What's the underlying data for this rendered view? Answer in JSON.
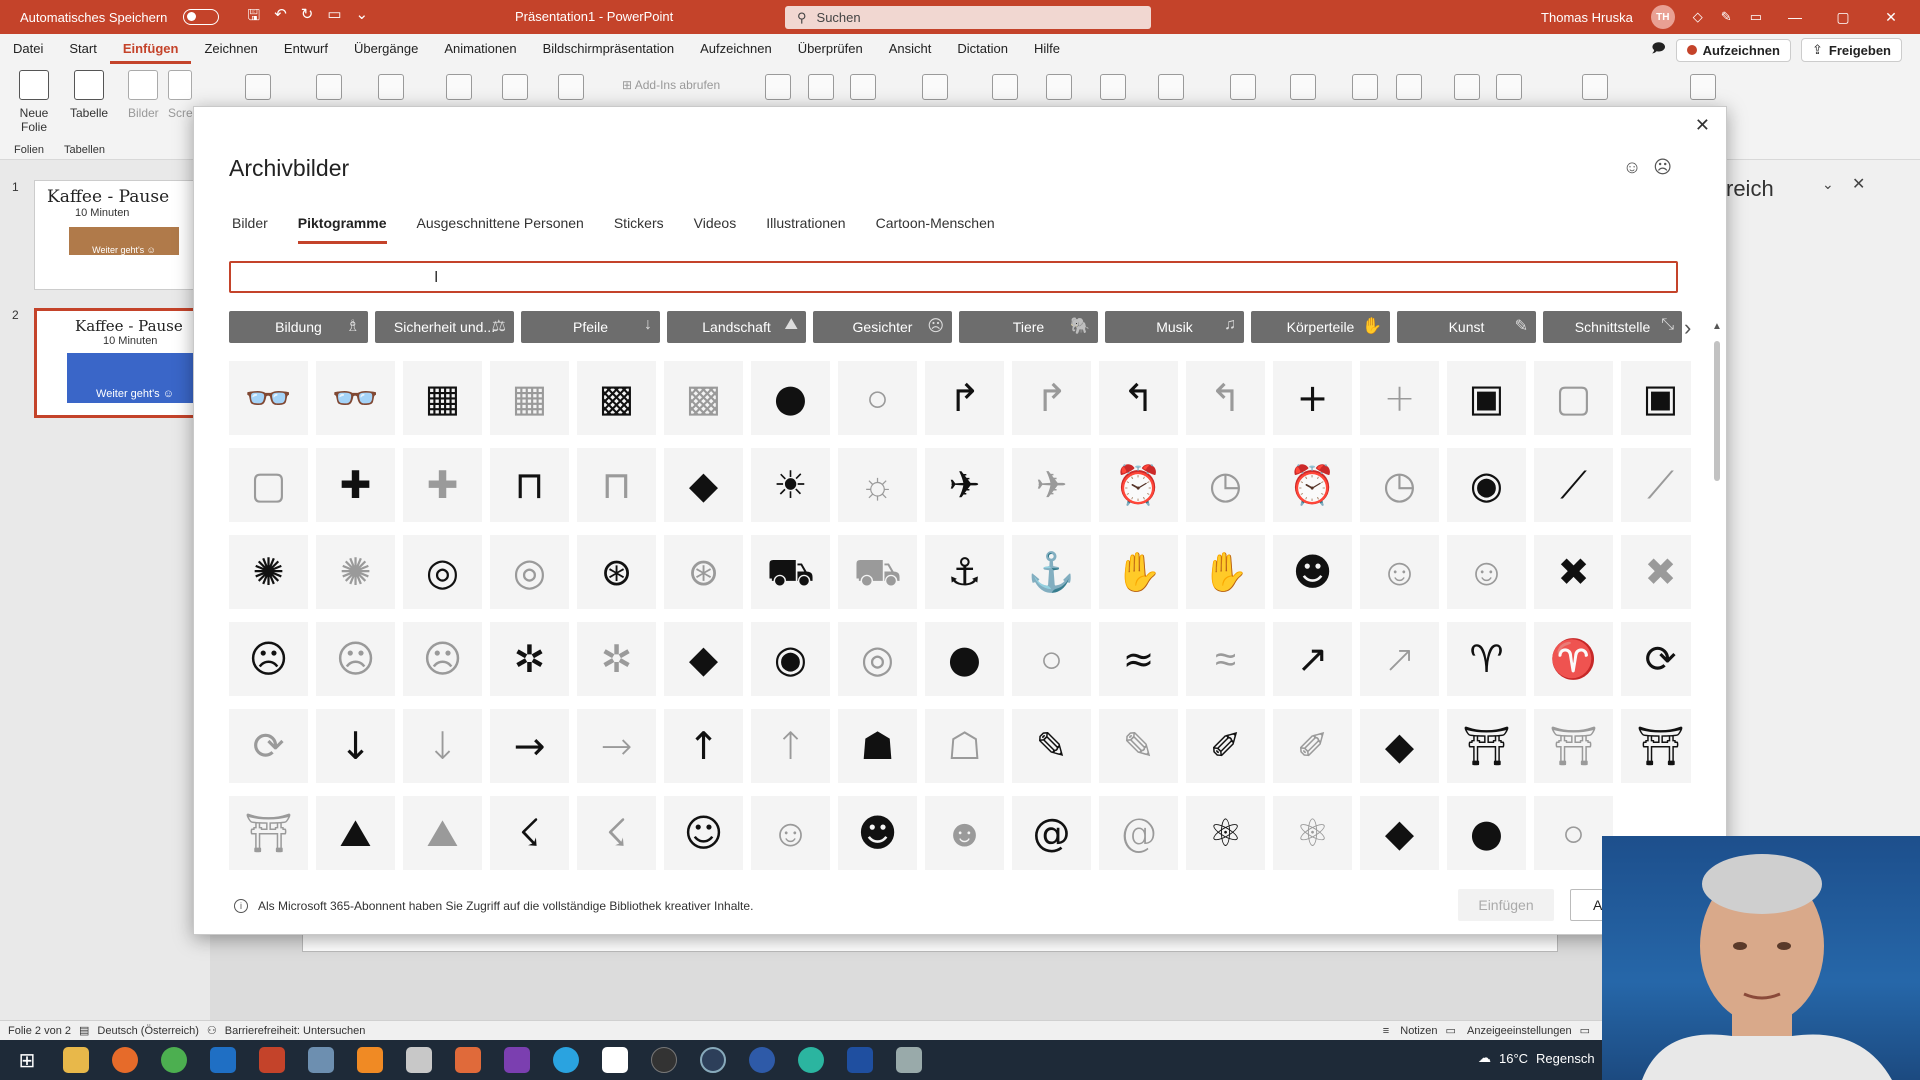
{
  "titlebar": {
    "autosave_label": "Automatisches Speichern",
    "doc_title": "Präsentation1 - PowerPoint",
    "search_placeholder": "Suchen",
    "user_name": "Thomas Hruska",
    "user_initials": "TH"
  },
  "menu": {
    "items": [
      "Datei",
      "Start",
      "Einfügen",
      "Zeichnen",
      "Entwurf",
      "Übergänge",
      "Animationen",
      "Bildschirmpräsentation",
      "Aufzeichnen",
      "Überprüfen",
      "Ansicht",
      "Dictation",
      "Hilfe"
    ],
    "active": "Einfügen",
    "record_btn": "Aufzeichnen",
    "share_btn": "Freigeben"
  },
  "ribbon": {
    "new_slide": "Neue Folie",
    "table": "Tabelle",
    "images": "Bilder",
    "screenshot": "Scre",
    "addins": "Add-Ins abrufen",
    "group_slides": "Folien",
    "group_tables": "Tabellen"
  },
  "slides": [
    {
      "num": "1",
      "title": "Kaffee - Pause",
      "sub": "10 Minuten",
      "banner": "Weiter geht's ☺"
    },
    {
      "num": "2",
      "title": "Kaffee - Pause",
      "sub": "10 Minuten",
      "banner": "Weiter geht's ☺"
    }
  ],
  "rightpane": {
    "title": "reich"
  },
  "dialog": {
    "title": "Archivbilder",
    "close": "✕",
    "tabs": [
      "Bilder",
      "Piktogramme",
      "Ausgeschnittene Personen",
      "Stickers",
      "Videos",
      "Illustrationen",
      "Cartoon-Menschen"
    ],
    "active_tab": "Piktogramme",
    "search_value": "",
    "categories": [
      {
        "label": "Bildung",
        "icon": "♗"
      },
      {
        "label": "Sicherheit und...",
        "icon": "⚖"
      },
      {
        "label": "Pfeile",
        "icon": "↓"
      },
      {
        "label": "Landschaft",
        "icon": "⛰"
      },
      {
        "label": "Gesichter",
        "icon": "☹"
      },
      {
        "label": "Tiere",
        "icon": "🐘"
      },
      {
        "label": "Musik",
        "icon": "♫"
      },
      {
        "label": "Körperteile",
        "icon": "✋"
      },
      {
        "label": "Kunst",
        "icon": "✎"
      },
      {
        "label": "Schnittstelle",
        "icon": "⤡"
      }
    ],
    "info_text": "Als Microsoft 365-Abonnent haben Sie Zugriff auf die vollständige Bibliothek kreativer Inhalte.",
    "insert_btn": "Einfügen",
    "cancel_btn": "Al"
  },
  "icons": [
    [
      "3d-glasses-icon",
      "👓",
      "s"
    ],
    [
      "3d-glasses-icon",
      "👓",
      "o"
    ],
    [
      "abacus-icon",
      "▦",
      "s"
    ],
    [
      "abacus-icon",
      "▦",
      "o"
    ],
    [
      "abacus-icon",
      "▩",
      "s"
    ],
    [
      "abacus-icon",
      "▩",
      "o"
    ],
    [
      "acorn-icon",
      "●",
      "s"
    ],
    [
      "acorn-icon",
      "○",
      "o"
    ],
    [
      "turn-right-icon",
      "↱",
      "s"
    ],
    [
      "turn-right-icon",
      "↱",
      "o"
    ],
    [
      "turn-left-icon",
      "↰",
      "s"
    ],
    [
      "turn-left-icon",
      "↰",
      "o"
    ],
    [
      "plus-icon",
      "+",
      "s"
    ],
    [
      "plus-icon",
      "+",
      "o"
    ],
    [
      "contact-card-icon",
      "▣",
      "s"
    ],
    [
      "contact-card-icon",
      "▢",
      "o"
    ],
    [
      "contact-card-icon",
      "▣",
      "s"
    ],
    [
      "contact-card-icon",
      "▢",
      "o"
    ],
    [
      "bandage-icon",
      "✚",
      "s"
    ],
    [
      "bandage-icon",
      "✚",
      "o"
    ],
    [
      "billboard-icon",
      "⊓",
      "s"
    ],
    [
      "billboard-icon",
      "⊓",
      "o"
    ],
    [
      "africa-icon",
      "◆",
      "s"
    ],
    [
      "landscape-icon",
      "☀",
      "s"
    ],
    [
      "landscape-icon",
      "☼",
      "o"
    ],
    [
      "airplane-icon",
      "✈",
      "s"
    ],
    [
      "airplane-icon",
      "✈",
      "o"
    ],
    [
      "alarm-clock-icon",
      "⏰",
      "s"
    ],
    [
      "alarm-clock-icon",
      "◷",
      "o"
    ],
    [
      "alarm-ringing-icon",
      "⏰",
      "s"
    ],
    [
      "alarm-ringing-icon",
      "◷",
      "o"
    ],
    [
      "alien-icon",
      "◉",
      "s"
    ],
    [
      "needle-icon",
      "⟋",
      "s"
    ],
    [
      "needle-icon",
      "⟋",
      "o"
    ],
    [
      "yarn-icon",
      "✺",
      "s"
    ],
    [
      "yarn-icon",
      "✺",
      "o"
    ],
    [
      "measuring-tape-icon",
      "◎",
      "s"
    ],
    [
      "measuring-tape-icon",
      "◎",
      "o"
    ],
    [
      "button-icon",
      "⊛",
      "s"
    ],
    [
      "button-icon",
      "⊛",
      "o"
    ],
    [
      "ambulance-icon",
      "⛟",
      "s"
    ],
    [
      "ambulance-icon",
      "⛟",
      "o"
    ],
    [
      "anchor-icon",
      "⚓",
      "s"
    ],
    [
      "anchor-icon",
      "⚓",
      "o"
    ],
    [
      "hand-icon",
      "✋",
      "s"
    ],
    [
      "hand-icon",
      "✋",
      "o"
    ],
    [
      "angel-face-icon",
      "☻",
      "s"
    ],
    [
      "angel-face-icon",
      "☺",
      "o"
    ],
    [
      "smile-face-icon",
      "☺",
      "o"
    ],
    [
      "angry-icon",
      "✖",
      "s"
    ],
    [
      "angry-icon",
      "✖",
      "o"
    ],
    [
      "sad-face-icon",
      "☹",
      "s"
    ],
    [
      "sad-face-icon",
      "☹",
      "o"
    ],
    [
      "frown-face-icon",
      "☹",
      "o"
    ],
    [
      "ant-icon",
      "✲",
      "s"
    ],
    [
      "ant-icon",
      "✲",
      "o"
    ],
    [
      "antarctica-icon",
      "◆",
      "s"
    ],
    [
      "aperture-icon",
      "◉",
      "s"
    ],
    [
      "aperture-icon",
      "◎",
      "o"
    ],
    [
      "apple-icon",
      "●",
      "s"
    ],
    [
      "apple-icon",
      "○",
      "o"
    ],
    [
      "aquarius-icon",
      "≈",
      "s"
    ],
    [
      "aquarius-icon",
      "≈",
      "o"
    ],
    [
      "chart-icon",
      "↗",
      "s"
    ],
    [
      "chart-icon",
      "↗",
      "o"
    ],
    [
      "aries-icon",
      "♈",
      "s"
    ],
    [
      "aries-icon",
      "♈",
      "o"
    ],
    [
      "refresh-icon",
      "⟳",
      "s"
    ],
    [
      "refresh-icon",
      "⟳",
      "o"
    ],
    [
      "arrow-down-icon",
      "↓",
      "s"
    ],
    [
      "arrow-down-icon",
      "↓",
      "o"
    ],
    [
      "arrow-right-icon",
      "→",
      "s"
    ],
    [
      "arrow-right-icon",
      "→",
      "o"
    ],
    [
      "arrow-up-icon",
      "↑",
      "s"
    ],
    [
      "arrow-up-icon",
      "↑",
      "o"
    ],
    [
      "brain-head-icon",
      "☗",
      "s"
    ],
    [
      "brain-head-icon",
      "☖",
      "o"
    ],
    [
      "painter-icon",
      "✎",
      "s"
    ],
    [
      "painter-icon",
      "✎",
      "o"
    ],
    [
      "painter-icon",
      "✐",
      "s"
    ],
    [
      "painter-icon",
      "✐",
      "o"
    ],
    [
      "asia-icon",
      "◆",
      "s"
    ],
    [
      "pagoda-icon",
      "⛩",
      "s"
    ],
    [
      "pagoda-icon",
      "⛩",
      "o"
    ],
    [
      "temple-icon",
      "⛩",
      "s"
    ],
    [
      "torii-icon",
      "⛩",
      "o"
    ],
    [
      "climber-icon",
      "⛰",
      "s"
    ],
    [
      "climber-icon",
      "⛰",
      "o"
    ],
    [
      "runner-icon",
      "☇",
      "s"
    ],
    [
      "runner-icon",
      "☇",
      "o"
    ],
    [
      "astronaut-icon",
      "☺",
      "s"
    ],
    [
      "astronaut-icon",
      "☺",
      "o"
    ],
    [
      "astronaut-icon",
      "☻",
      "s"
    ],
    [
      "astronaut-icon",
      "☻",
      "o"
    ],
    [
      "at-sign-icon",
      "@",
      "s"
    ],
    [
      "at-sign-icon",
      "@",
      "o"
    ],
    [
      "atom-icon",
      "⚛",
      "s"
    ],
    [
      "atom-icon",
      "⚛",
      "o"
    ],
    [
      "australia-icon",
      "◆",
      "s"
    ],
    [
      "avocado-icon",
      "●",
      "s"
    ],
    [
      "avocado-icon",
      "○",
      "o"
    ]
  ],
  "status": {
    "slide_info": "Folie 2 von 2",
    "language": "Deutsch (Österreich)",
    "accessibility": "Barrierefreiheit: Untersuchen",
    "notes": "Notizen",
    "display": "Anzeigeeinstellungen"
  },
  "taskbar": {
    "weather": "16°C",
    "weather_text": "Regensch"
  }
}
